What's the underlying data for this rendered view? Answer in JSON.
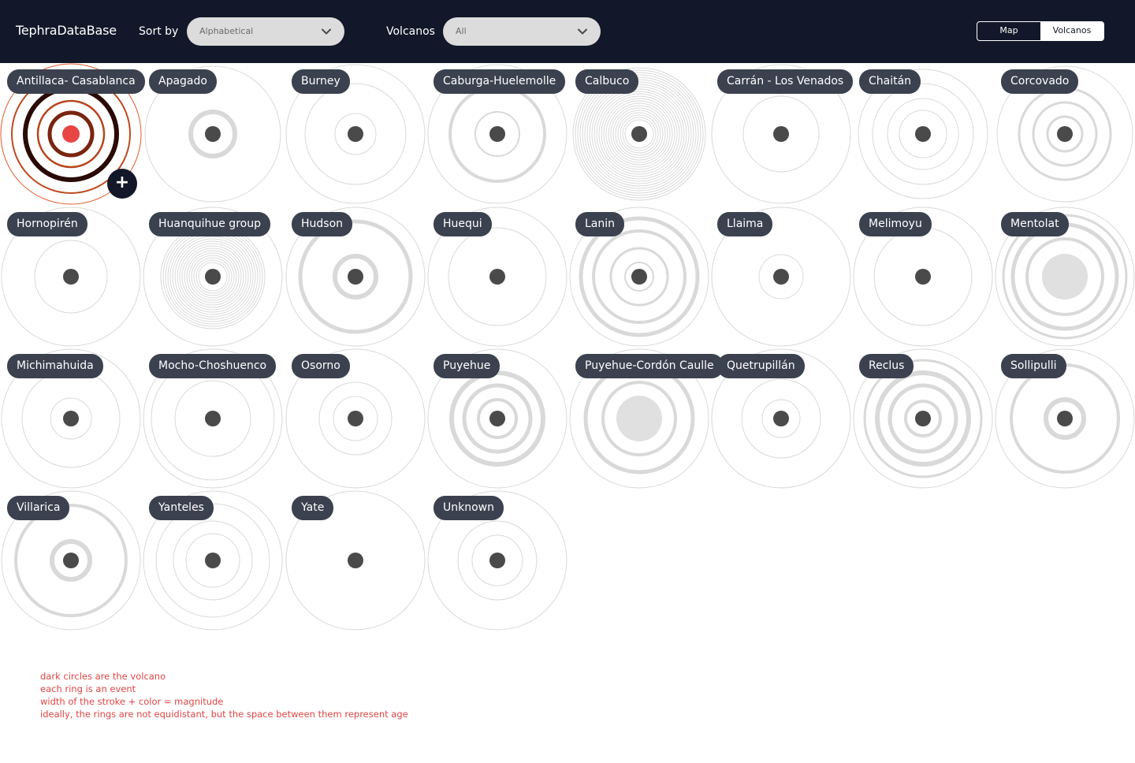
{
  "header": {
    "brand": "TephraDataBase",
    "sort_label": "Sort by",
    "sort_value": "Alphabetical",
    "volcanos_label": "Volcanos",
    "volcanos_value": "All",
    "view_map": "Map",
    "view_volcanos": "Volcanos",
    "active_view": "Volcanos"
  },
  "colors": {
    "header_bg": "#121829",
    "badge_bg": "#3c4150",
    "ring_grey": "#d9d9d9",
    "dot_dark": "#4a4a4a",
    "accent_red": "#e84545"
  },
  "volcanoes": [
    {
      "name": "Antillaca- Casablanca",
      "selected": true
    },
    {
      "name": "Apagado"
    },
    {
      "name": "Burney"
    },
    {
      "name": "Caburga-Huelemolle"
    },
    {
      "name": "Calbuco"
    },
    {
      "name": "Carrán - Los Venados"
    },
    {
      "name": "Chaitán"
    },
    {
      "name": "Corcovado"
    },
    {
      "name": "Hornopirén"
    },
    {
      "name": "Huanquihue group"
    },
    {
      "name": "Hudson"
    },
    {
      "name": "Huequi"
    },
    {
      "name": "Lanin"
    },
    {
      "name": "Llaima"
    },
    {
      "name": "Melimoyu"
    },
    {
      "name": "Mentolat"
    },
    {
      "name": "Michimahuida"
    },
    {
      "name": "Mocho-Choshuenco"
    },
    {
      "name": "Osorno"
    },
    {
      "name": "Puyehue"
    },
    {
      "name": "Puyehue-Cordón Caulle"
    },
    {
      "name": "Quetrupillán"
    },
    {
      "name": "Reclus"
    },
    {
      "name": "Sollipulli"
    },
    {
      "name": "Villarica"
    },
    {
      "name": "Yanteles"
    },
    {
      "name": "Yate"
    },
    {
      "name": "Unknown"
    }
  ],
  "notes": [
    "dark circles are the volcano",
    "each ring is an event",
    "width of the stroke + color = magnitude",
    "ideally, the rings are not equidistant, but the space between them represent age"
  ],
  "icons": {
    "add": "plus-icon",
    "dropdown": "chevron-down-icon"
  }
}
